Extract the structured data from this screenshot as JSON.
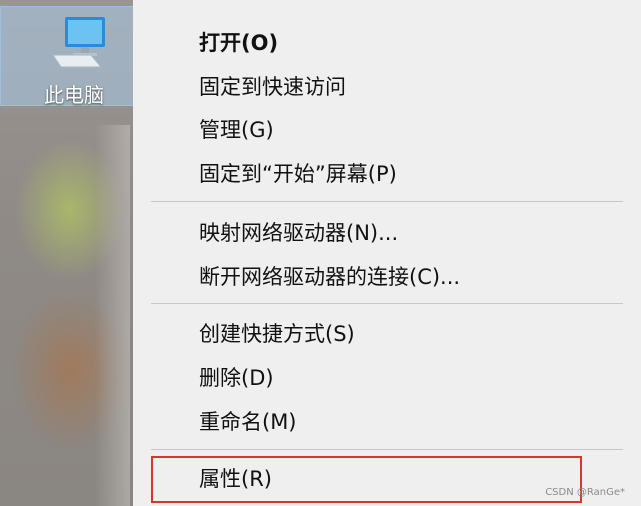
{
  "desktop": {
    "icon_label": "此电脑"
  },
  "context_menu": {
    "items": [
      {
        "label": "打开(O)",
        "bold": true
      },
      {
        "label": "固定到快速访问"
      },
      {
        "label": "管理(G)"
      },
      {
        "label": "固定到“开始”屏幕(P)"
      },
      {
        "label": "映射网络驱动器(N)..."
      },
      {
        "label": "断开网络驱动器的连接(C)..."
      },
      {
        "label": "创建快捷方式(S)"
      },
      {
        "label": "删除(D)"
      },
      {
        "label": "重命名(M)"
      },
      {
        "label": "属性(R)"
      }
    ]
  },
  "watermark": "CSDN @RanGe*",
  "colors": {
    "highlight_border": "#d8362b",
    "menu_background": "#efefef"
  }
}
